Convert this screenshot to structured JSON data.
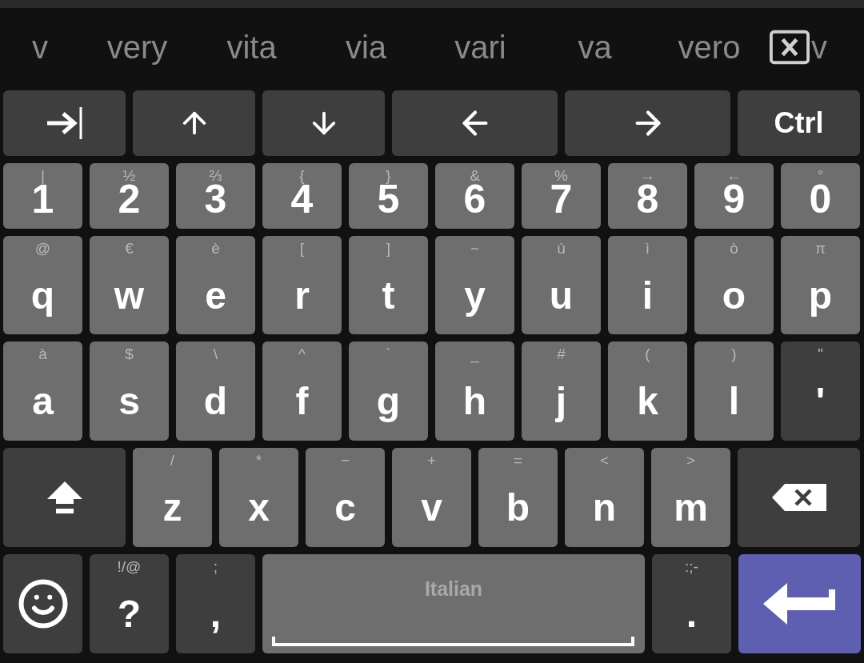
{
  "suggestions": [
    "v",
    "very",
    "vita",
    "via",
    "vari",
    "va",
    "vero"
  ],
  "suggestion_tail": "v",
  "rows": [
    [
      {
        "kind": "tab"
      },
      {
        "kind": "up"
      },
      {
        "kind": "down"
      },
      {
        "kind": "left"
      },
      {
        "kind": "right"
      },
      {
        "kind": "modifier",
        "label": "Ctrl"
      }
    ],
    [
      {
        "kind": "letter",
        "hint": "|",
        "label": "1"
      },
      {
        "kind": "letter",
        "hint": "½",
        "label": "2"
      },
      {
        "kind": "letter",
        "hint": "⅔",
        "label": "3"
      },
      {
        "kind": "letter",
        "hint": "{",
        "label": "4"
      },
      {
        "kind": "letter",
        "hint": "}",
        "label": "5"
      },
      {
        "kind": "letter",
        "hint": "&",
        "label": "6"
      },
      {
        "kind": "letter",
        "hint": "%",
        "label": "7"
      },
      {
        "kind": "letter",
        "hint": "→",
        "label": "8"
      },
      {
        "kind": "letter",
        "hint": "←",
        "label": "9"
      },
      {
        "kind": "letter",
        "hint": "°",
        "label": "0"
      }
    ],
    [
      {
        "kind": "letter",
        "hint": "@",
        "label": "q"
      },
      {
        "kind": "letter",
        "hint": "€",
        "label": "w"
      },
      {
        "kind": "letter",
        "hint": "è",
        "label": "e"
      },
      {
        "kind": "letter",
        "hint": "[",
        "label": "r"
      },
      {
        "kind": "letter",
        "hint": "]",
        "label": "t"
      },
      {
        "kind": "letter",
        "hint": "~",
        "label": "y"
      },
      {
        "kind": "letter",
        "hint": "ù",
        "label": "u"
      },
      {
        "kind": "letter",
        "hint": "ì",
        "label": "i"
      },
      {
        "kind": "letter",
        "hint": "ò",
        "label": "o"
      },
      {
        "kind": "letter",
        "hint": "π",
        "label": "p"
      }
    ],
    [
      {
        "kind": "letter",
        "hint": "à",
        "label": "a"
      },
      {
        "kind": "letter",
        "hint": "$",
        "label": "s"
      },
      {
        "kind": "letter",
        "hint": "\\",
        "label": "d"
      },
      {
        "kind": "letter",
        "hint": "^",
        "label": "f"
      },
      {
        "kind": "letter",
        "hint": "`",
        "label": "g"
      },
      {
        "kind": "letter",
        "hint": "_",
        "label": "h"
      },
      {
        "kind": "letter",
        "hint": "#",
        "label": "j"
      },
      {
        "kind": "letter",
        "hint": "(",
        "label": "k"
      },
      {
        "kind": "letter",
        "hint": ")",
        "label": "l"
      },
      {
        "kind": "symbol",
        "hint": "\"",
        "label": "'"
      }
    ],
    [
      {
        "kind": "shift"
      },
      {
        "kind": "letter",
        "hint": "/",
        "label": "z"
      },
      {
        "kind": "letter",
        "hint": "*",
        "label": "x"
      },
      {
        "kind": "letter",
        "hint": "−",
        "label": "c"
      },
      {
        "kind": "letter",
        "hint": "+",
        "label": "v"
      },
      {
        "kind": "letter",
        "hint": "=",
        "label": "b"
      },
      {
        "kind": "letter",
        "hint": "<",
        "label": "n"
      },
      {
        "kind": "letter",
        "hint": ">",
        "label": "m"
      },
      {
        "kind": "backspace"
      }
    ],
    [
      {
        "kind": "emoji"
      },
      {
        "kind": "symbol",
        "hint": "!/@",
        "label": "?"
      },
      {
        "kind": "symbol",
        "hint": ";",
        "label": ","
      },
      {
        "kind": "space",
        "label": "Italian"
      },
      {
        "kind": "symbol",
        "hint": ":;-",
        "label": "."
      },
      {
        "kind": "enter"
      }
    ]
  ]
}
